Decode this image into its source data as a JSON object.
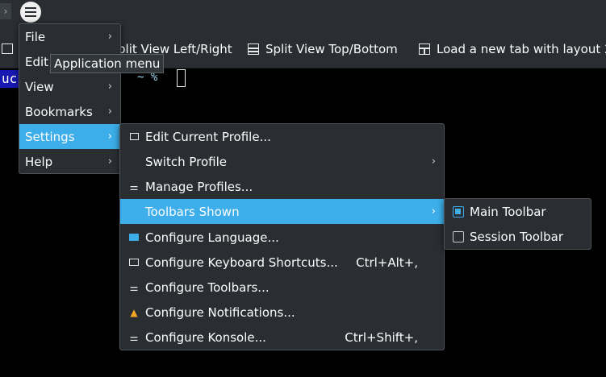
{
  "toolbar": {
    "split_left_right": "plit View Left/Right",
    "split_top_bottom": "Split View Top/Bottom",
    "load_layout": "Load a new tab with layout 2"
  },
  "terminal": {
    "prompt_fragment": "uc",
    "tail": "~ %"
  },
  "tooltip": "Application menu",
  "app_menu": [
    {
      "label": "File"
    },
    {
      "label": "Edit"
    },
    {
      "label": "View"
    },
    {
      "label": "Bookmarks"
    },
    {
      "label": "Settings"
    },
    {
      "label": "Help"
    }
  ],
  "settings_menu": [
    {
      "label": "Edit Current Profile...",
      "shortcut": "",
      "icon": "edit-profile-icon"
    },
    {
      "label": "Switch Profile",
      "shortcut": "",
      "icon": ""
    },
    {
      "label": "Manage Profiles...",
      "shortcut": "",
      "icon": "sliders-icon"
    },
    {
      "label": "Toolbars Shown",
      "shortcut": "",
      "icon": ""
    },
    {
      "label": "Configure Language...",
      "shortcut": "",
      "icon": "language-icon"
    },
    {
      "label": "Configure Keyboard Shortcuts...",
      "shortcut": "Ctrl+Alt+,",
      "icon": "keyboard-icon"
    },
    {
      "label": "Configure Toolbars...",
      "shortcut": "",
      "icon": "sliders-icon"
    },
    {
      "label": "Configure Notifications...",
      "shortcut": "",
      "icon": "bell-icon"
    },
    {
      "label": "Configure Konsole...",
      "shortcut": "Ctrl+Shift+,",
      "icon": "sliders-icon"
    }
  ],
  "toolbars_menu": [
    {
      "label": "Main Toolbar",
      "checked": true
    },
    {
      "label": "Session Toolbar",
      "checked": false
    }
  ],
  "colors": {
    "highlight": "#3daee9",
    "menu_bg": "#2a2e32"
  }
}
